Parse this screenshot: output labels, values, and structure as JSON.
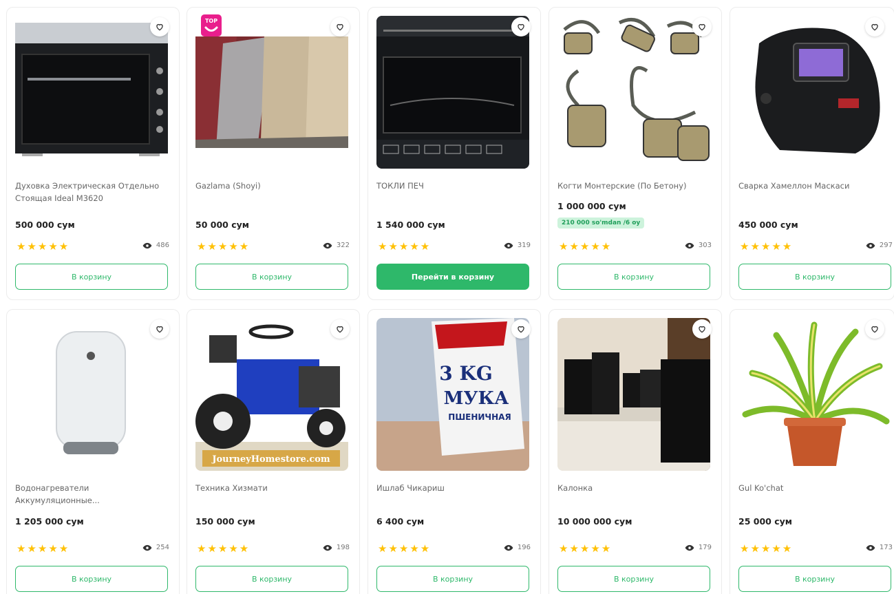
{
  "currency_note": "сум",
  "products": [
    {
      "title": "Духовка Электрическая Отдельно Стоящая Ideal M3620",
      "price": "500 000 сум",
      "views": "486",
      "button": "В корзину",
      "stars": "★★★★★"
    },
    {
      "title": "Gazlama (Shoyi)",
      "price": "50 000 сум",
      "views": "322",
      "button": "В корзину",
      "stars": "★★★★★",
      "badge": "TOP"
    },
    {
      "title": "ТОКЛИ ПЕЧ",
      "price": "1 540 000 сум",
      "views": "319",
      "button": "Перейти в корзину",
      "stars": "★★★★★"
    },
    {
      "title": "Когти Монтерские (По Бетону)",
      "price": "1 000 000 сум",
      "installment": "210 000 so'mdan /6 oy",
      "views": "303",
      "button": "В корзину",
      "stars": "★★★★★"
    },
    {
      "title": "Сварка Хамеллон Маскаси",
      "price": "450 000 сум",
      "views": "297",
      "button": "В корзину",
      "stars": "★★★★★"
    },
    {
      "title": "Водонагреватели Аккумуляционные...",
      "price": "1 205 000 сум",
      "views": "254",
      "button": "В корзину",
      "stars": "★★★★★"
    },
    {
      "title": "Техника Хизмати",
      "price": "150 000 сум",
      "views": "198",
      "button": "В корзину",
      "stars": "★★★★★",
      "watermark": "JourneyHomestore.com"
    },
    {
      "title": "Ишлаб Чикариш",
      "price": "6 400 сум",
      "views": "196",
      "button": "В корзину",
      "stars": "★★★★★",
      "label_big": "3 KG",
      "label_word": "МУКА",
      "label_sub": "ПШЕНИЧНАЯ"
    },
    {
      "title": "Калонка",
      "price": "10 000 000 сум",
      "views": "179",
      "button": "В корзину",
      "stars": "★★★★★"
    },
    {
      "title": "Gul Ko'chat",
      "price": "25 000 сум",
      "views": "173",
      "button": "В корзину",
      "stars": "★★★★★"
    }
  ],
  "colors": {
    "accent": "#2eb86a",
    "star": "#ffc107",
    "badge": "#e91e8c"
  },
  "icons": {
    "favorite": "heart-outline-icon",
    "views": "eye-icon",
    "star": "star-icon"
  }
}
